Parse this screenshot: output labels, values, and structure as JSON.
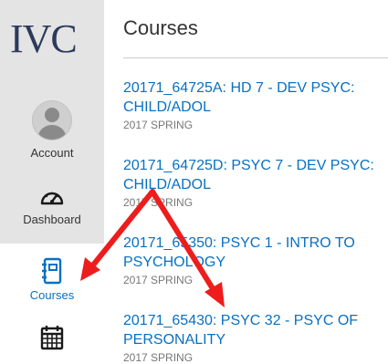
{
  "logo": "IVC",
  "nav": {
    "account": "Account",
    "dashboard": "Dashboard",
    "courses": "Courses"
  },
  "page": {
    "title": "Courses"
  },
  "courses": [
    {
      "name": "20171_64725A: HD 7 - DEV PSYC: CHILD/ADOL",
      "term": "2017 SPRING"
    },
    {
      "name": "20171_64725D: PSYC 7 - DEV PSYC: CHILD/ADOL",
      "term": "2017 SPRING"
    },
    {
      "name": "20171_65350: PSYC 1 - INTRO TO PSYCHOLOGY",
      "term": "2017 SPRING"
    },
    {
      "name": "20171_65430: PSYC 32 - PSYC OF PERSONALITY",
      "term": "2017 SPRING"
    }
  ],
  "colors": {
    "link": "#0770c3",
    "sidebar": "#e4e4e4",
    "annotation_arrow": "#ee1c1c"
  },
  "icons": [
    "user-avatar-icon",
    "dashboard-speedometer-icon",
    "courses-notebook-icon",
    "calendar-icon"
  ]
}
